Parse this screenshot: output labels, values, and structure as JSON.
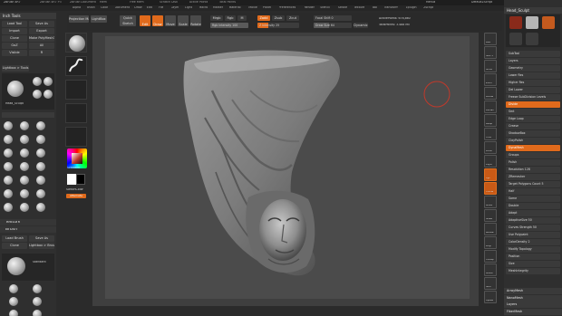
{
  "titlebar": {
    "app": "ZBrush 4R7",
    "items": [
      "ZBrush 4R7 P3",
      "ZBrush Document",
      "Mem",
      "Free Mem",
      "Scratch Disk",
      "Active Points",
      "Total Points"
    ],
    "right_items": [
      "Menus",
      "DefaultZScript",
      "?"
    ]
  },
  "menubar": {
    "items": [
      "Alpha",
      "Brush",
      "Color",
      "Document",
      "Draw",
      "Edit",
      "File",
      "Layer",
      "Light",
      "Macro",
      "Marker",
      "Material",
      "Movie",
      "Picker",
      "Preferences",
      "Render",
      "Stencil",
      "Stroke",
      "Texture",
      "Tool",
      "Transform",
      "Zplugin",
      "Zscript"
    ]
  },
  "top_toolbar": {
    "projection_master": "Projection Master",
    "lightbox": "LightBox",
    "quick_sketch": "Quick Sketch",
    "edit": "Edit",
    "draw": "Draw",
    "move": "Move",
    "scale": "Scale",
    "rotate": "Rotate",
    "mrgb": "Mrgb",
    "rgb": "Rgb",
    "m": "M",
    "zadd": "Zadd",
    "zsub": "Zsub",
    "zcut": "Zcut",
    "focal_shift": "Focal Shift 0",
    "draw_size": "Draw Size 64",
    "dynamic": "Dynamic",
    "rgb_intensity": "Rgb Intensity 100",
    "z_intensity": "Z Intensity 25",
    "active_points": "ActivePoints: 676,860",
    "total_points": "TotalPoints: 3.488 Mil"
  },
  "left_panel": {
    "title": "Inch Tools",
    "buttons": [
      "Load Tool",
      "Save As",
      "Import",
      "Export",
      "Clone",
      "Make PolyMesh3D",
      "GoZ",
      "All",
      "Visible",
      "R"
    ],
    "lightbox_tools": "Lightbox > Tools",
    "tool_name": "Head_Sculpt",
    "tool_size": "48",
    "texture_label": "Texture",
    "brush_label": "Brush",
    "brush_buttons": [
      "Load Brush",
      "Save As",
      "Clone",
      "Lightbox > Brush"
    ],
    "brush_standard": "Standard",
    "brush_count": "1.0"
  },
  "brush_strip": {
    "gradient": "Gradient",
    "switchcolor": "SwitchColor",
    "alternate": "Alternate"
  },
  "right_panel": {
    "title": "Head_Sculpt",
    "tabs": [
      "Tool",
      "Subtool",
      "Layers",
      "Geometry"
    ],
    "sections": [
      {
        "label": "SubTool",
        "highlight": false
      },
      {
        "label": "Layers",
        "highlight": false
      },
      {
        "label": "Geometry",
        "highlight": false
      },
      {
        "label": "Lower Res",
        "highlight": false
      },
      {
        "label": "Higher Res",
        "highlight": false
      },
      {
        "label": "Del Lower",
        "highlight": false
      },
      {
        "label": "Freeze SubDivision Levels",
        "highlight": false
      },
      {
        "label": "Divide",
        "highlight": true
      },
      {
        "label": "Smt",
        "highlight": false
      },
      {
        "label": "Edge Loop",
        "highlight": false
      },
      {
        "label": "Crease",
        "highlight": false
      },
      {
        "label": "ShadowBox",
        "highlight": false
      },
      {
        "label": "ClayPolish",
        "highlight": false
      },
      {
        "label": "DynaMesh",
        "highlight": true
      },
      {
        "label": "Groups",
        "highlight": false
      },
      {
        "label": "Polish",
        "highlight": false
      },
      {
        "label": "Resolution 128",
        "highlight": false
      },
      {
        "label": "ZRemesher",
        "highlight": false
      },
      {
        "label": "Target Polygons Count 5",
        "highlight": false
      },
      {
        "label": "Half",
        "highlight": false
      },
      {
        "label": "Same",
        "highlight": false
      },
      {
        "label": "Double",
        "highlight": false
      },
      {
        "label": "Adapt",
        "highlight": false
      },
      {
        "label": "AdaptiveSize 50",
        "highlight": false
      },
      {
        "label": "Curves Strength 50",
        "highlight": false
      },
      {
        "label": "Use Polypaint",
        "highlight": false
      },
      {
        "label": "ColorDensity 2",
        "highlight": false
      },
      {
        "label": "Modify Topology",
        "highlight": false
      },
      {
        "label": "Position",
        "highlight": false
      },
      {
        "label": "Size",
        "highlight": false
      },
      {
        "label": "MeshIntegrity",
        "highlight": false
      }
    ],
    "bottom_sections": [
      "ArrayMesh",
      "NanoMesh",
      "Layers",
      "FiberMesh",
      "Geometry HD",
      "Preview",
      "Surface",
      "Deformation"
    ]
  },
  "right_icon_bar": {
    "icons": [
      "BPR",
      "SPix 3",
      "Scroll",
      "Zoom",
      "Actual",
      "AAHalf",
      "Persp",
      "Floor",
      "Local",
      "LSym",
      "Xyz",
      "Frame",
      "Move",
      "Scale",
      "Rotate",
      "PolyF",
      "Transp",
      "Ghost",
      "Solo",
      "Xpose"
    ]
  },
  "colors": {
    "accent": "#e06a1c",
    "panel": "#2f2f2f",
    "canvas": "#4b4b4b",
    "brush_cursor": "#c0392b"
  }
}
